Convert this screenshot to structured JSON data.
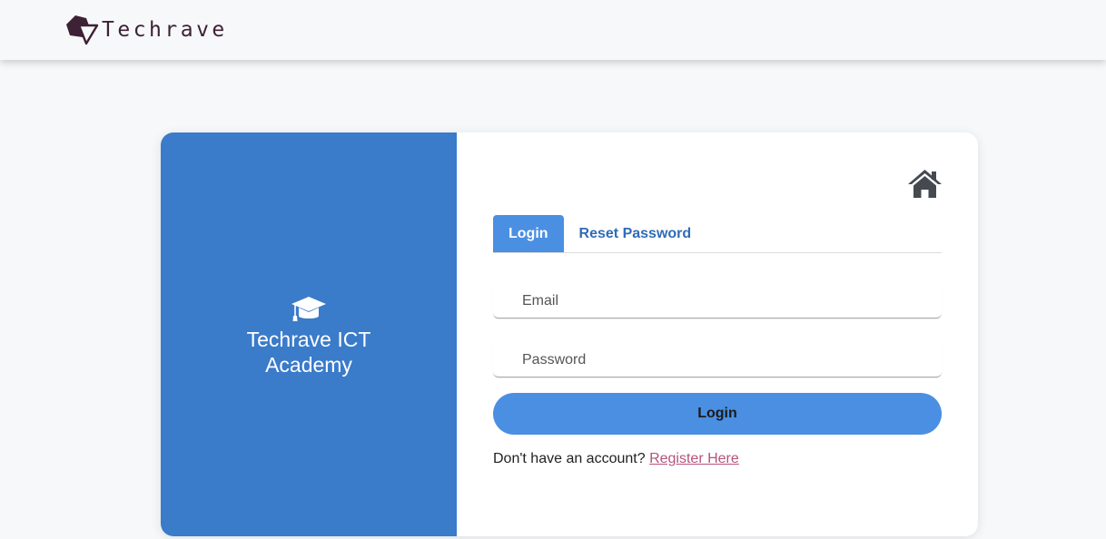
{
  "header": {
    "brand_name": "Techrave",
    "logo_icon": "hexagon-triangle-logo",
    "brand_color": "#3d2135"
  },
  "left_panel": {
    "icon": "graduation-cap-icon",
    "title": "Techrave ICT Academy",
    "background_color": "#3a7bca"
  },
  "form": {
    "home_icon": "home-icon",
    "tabs": [
      {
        "label": "Login",
        "active": true
      },
      {
        "label": "Reset Password",
        "active": false
      }
    ],
    "email_placeholder": "Email",
    "password_placeholder": "Password",
    "submit_label": "Login",
    "register_prompt": "Don't have an account?",
    "register_link": "Register Here",
    "accent_color": "#4a8fe2",
    "link_color": "#b5537c"
  }
}
